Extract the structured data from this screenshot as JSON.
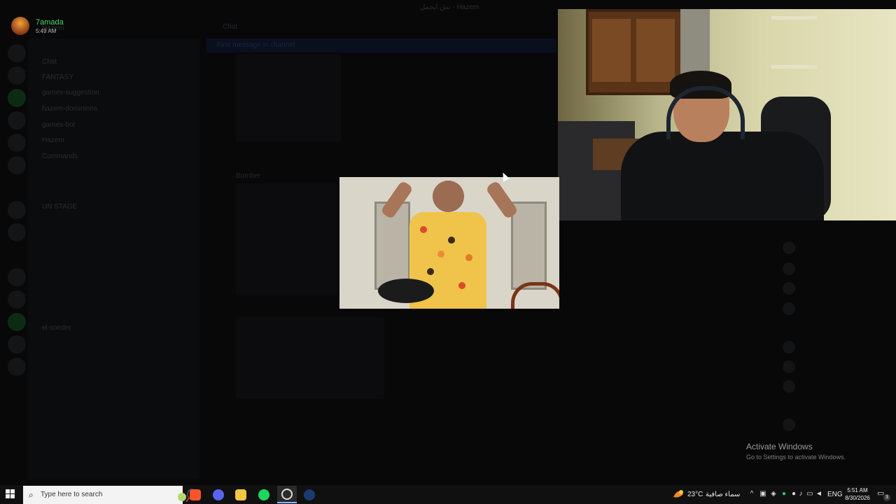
{
  "window": {
    "title": "تش ايجمل - Hazem"
  },
  "user": {
    "name": "7amada",
    "time": "5:49 AM"
  },
  "server": {
    "name": "Hazem"
  },
  "channel_list": [
    "Chat",
    "FANTASY",
    "games-suggestion",
    "hazem-dominions",
    "games-bot",
    "Hazem",
    "Commands",
    "UN STAGE",
    "el-soeder"
  ],
  "main": {
    "channel": "Chat",
    "sender": "Bomber",
    "banner": "First message in channel"
  },
  "overlays": {
    "webcam": "webcam-feed",
    "gif": "gif-clip"
  },
  "activation": {
    "title": "Activate Windows",
    "subtitle": "Go to Settings to activate Windows."
  },
  "taskbar": {
    "search_placeholder": "Type here to search",
    "apps": [
      "brave-icon",
      "discord-icon",
      "file-explorer-icon",
      "spotify-icon",
      "obs-icon",
      "steam-icon"
    ],
    "weather_temp": "23°C",
    "weather_text": "سماء صافية",
    "language": "ENG",
    "time": "5:51 AM",
    "date": "8/30/2026",
    "notifications": "3"
  },
  "colors": {
    "username": "#4bd46f",
    "taskbar": "#101010",
    "search_box": "#f3f3f3"
  }
}
